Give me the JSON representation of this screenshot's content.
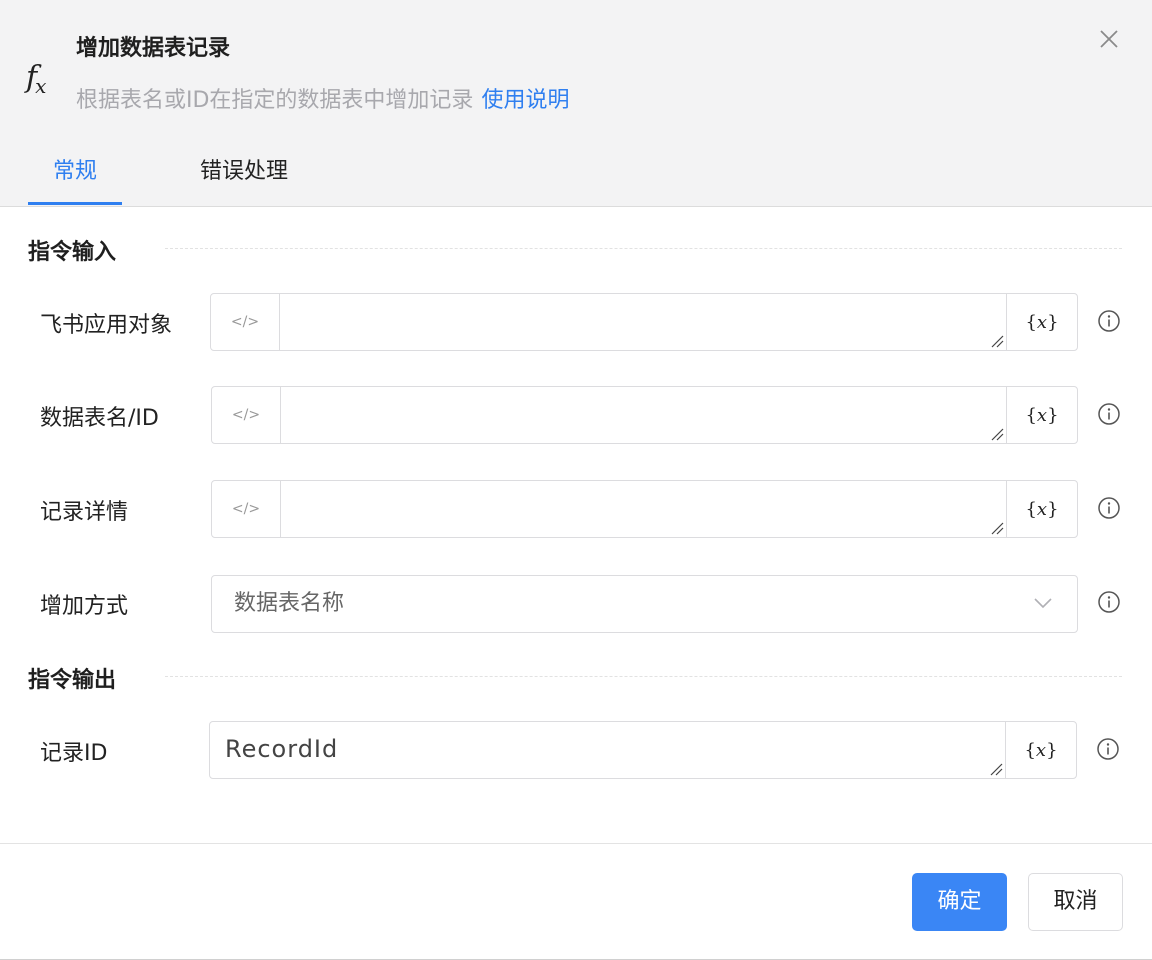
{
  "header": {
    "icon": "fx-icon",
    "title": "增加数据表记录",
    "description": "根据表名或ID在指定的数据表中增加记录",
    "help_link": "使用说明",
    "close_icon": "close-icon"
  },
  "tabs": [
    {
      "label": "常规",
      "active": true
    },
    {
      "label": "错误处理",
      "active": false
    }
  ],
  "sections": {
    "input_title": "指令输入",
    "output_title": "指令输出"
  },
  "fields": {
    "feishu_app": {
      "label": "飞书应用对象",
      "value": ""
    },
    "table_name": {
      "label": "数据表名/ID",
      "value": ""
    },
    "record_detail": {
      "label": "记录详情",
      "value": ""
    },
    "add_mode": {
      "label": "增加方式",
      "selected": "数据表名称"
    },
    "record_id": {
      "label": "记录ID",
      "value": "RecordId"
    }
  },
  "buttons": {
    "code_symbol": "</>",
    "var_symbol_open": "{",
    "var_symbol_x": "x",
    "var_symbol_close": "}",
    "confirm": "确定",
    "cancel": "取消"
  },
  "colors": {
    "accent": "#2f7ff0",
    "primary_button": "#3a86f5",
    "header_bg": "#f3f3f4"
  }
}
